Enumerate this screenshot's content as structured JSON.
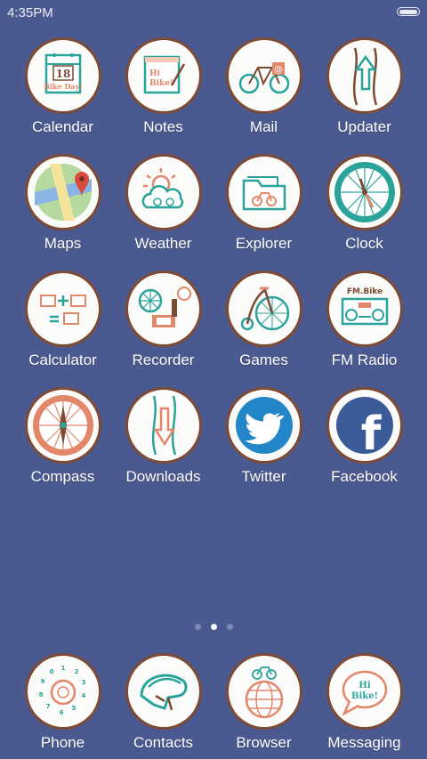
{
  "status_bar": {
    "time": "4:35PM"
  },
  "apps": [
    {
      "label": "Calendar",
      "icon": "calendar-icon",
      "icon_text": "18",
      "icon_subtext": "Bike Day!"
    },
    {
      "label": "Notes",
      "icon": "notes-icon",
      "icon_text": "Hi",
      "icon_subtext": "Bike!"
    },
    {
      "label": "Mail",
      "icon": "mail-bicycle-icon",
      "icon_text": "@"
    },
    {
      "label": "Updater",
      "icon": "updater-road-icon"
    },
    {
      "label": "Maps",
      "icon": "maps-icon"
    },
    {
      "label": "Weather",
      "icon": "weather-icon"
    },
    {
      "label": "Explorer",
      "icon": "folder-icon"
    },
    {
      "label": "Clock",
      "icon": "clock-wheel-icon"
    },
    {
      "label": "Calculator",
      "icon": "calculator-icon"
    },
    {
      "label": "Recorder",
      "icon": "recorder-icon"
    },
    {
      "label": "Games",
      "icon": "penny-farthing-icon"
    },
    {
      "label": "FM Radio",
      "icon": "radio-icon",
      "icon_text": "FM.Bike"
    },
    {
      "label": "Compass",
      "icon": "compass-wheel-icon"
    },
    {
      "label": "Downloads",
      "icon": "downloads-road-icon"
    },
    {
      "label": "Twitter",
      "icon": "twitter-bird-icon"
    },
    {
      "label": "Facebook",
      "icon": "facebook-icon",
      "icon_text": "f"
    }
  ],
  "page_indicator": {
    "count": 3,
    "active_index": 1
  },
  "dock": [
    {
      "label": "Phone",
      "icon": "phone-dial-icon"
    },
    {
      "label": "Contacts",
      "icon": "helmet-icon"
    },
    {
      "label": "Browser",
      "icon": "globe-bike-icon"
    },
    {
      "label": "Messaging",
      "icon": "speech-bubble-icon",
      "icon_text": "Hi",
      "icon_subtext": "Bike!"
    }
  ],
  "colors": {
    "background": "#4a5a90",
    "icon_ring": "#7c4a35",
    "teal": "#2aa39a",
    "orange": "#e2876a"
  }
}
